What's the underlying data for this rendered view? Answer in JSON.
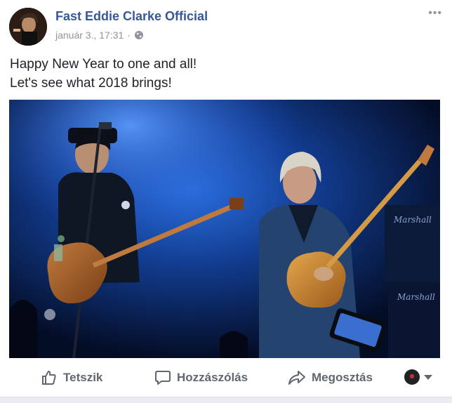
{
  "post": {
    "page_name": "Fast Eddie Clarke Official",
    "timestamp": "január 3., 17:31",
    "separator": "·",
    "privacy_icon": "globe-icon",
    "more_icon": "more-options-icon",
    "more_glyph": "•••",
    "text_lines": [
      "Happy New Year to one and all!",
      "Let's see what 2018 brings!"
    ]
  },
  "actions": {
    "like_label": "Tetszik",
    "comment_label": "Hozzászólás",
    "share_label": "Megosztás"
  },
  "colors": {
    "link": "#365899",
    "meta": "#90949c",
    "action": "#606770",
    "stage_blue": "#1c57c8"
  }
}
